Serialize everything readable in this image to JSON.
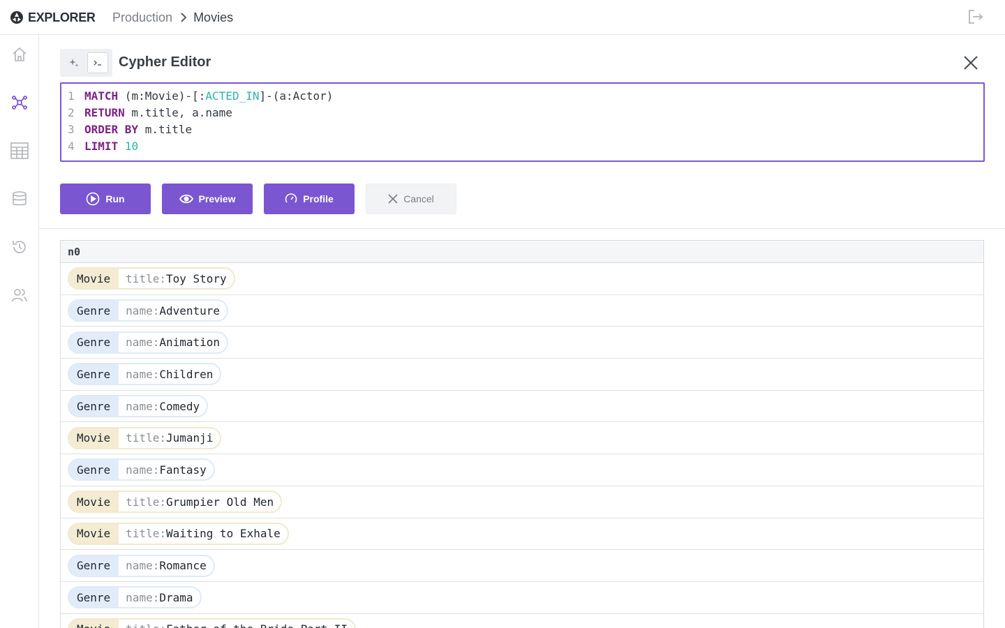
{
  "header": {
    "logo_text": "EXPLORER",
    "breadcrumb": {
      "parent": "Production",
      "current": "Movies"
    },
    "logout_icon": "logout-icon"
  },
  "sidebar": {
    "items": [
      {
        "name": "home",
        "icon": "home-icon",
        "active": false
      },
      {
        "name": "graph",
        "icon": "graph-icon",
        "active": true
      },
      {
        "name": "table",
        "icon": "table-icon",
        "active": false
      },
      {
        "name": "database",
        "icon": "database-icon",
        "active": false
      },
      {
        "name": "history",
        "icon": "history-icon",
        "active": false
      },
      {
        "name": "users",
        "icon": "users-icon",
        "active": false
      }
    ]
  },
  "editor": {
    "title": "Cypher Editor",
    "lines": [
      {
        "n": "1",
        "tokens": [
          {
            "t": "kw",
            "v": "MATCH"
          },
          {
            "t": "plain",
            "v": " (m:Movie)-[:"
          },
          {
            "t": "typ",
            "v": "ACTED_IN"
          },
          {
            "t": "plain",
            "v": "]-(a:Actor)"
          }
        ]
      },
      {
        "n": "2",
        "tokens": [
          {
            "t": "kw",
            "v": "RETURN"
          },
          {
            "t": "plain",
            "v": " m.title, a.name"
          }
        ]
      },
      {
        "n": "3",
        "tokens": [
          {
            "t": "kw",
            "v": "ORDER BY"
          },
          {
            "t": "plain",
            "v": " m.title"
          }
        ]
      },
      {
        "n": "4",
        "tokens": [
          {
            "t": "kw",
            "v": "LIMIT"
          },
          {
            "t": "plain",
            "v": " "
          },
          {
            "t": "num",
            "v": "10"
          }
        ]
      }
    ],
    "buttons": {
      "run": "Run",
      "preview": "Preview",
      "profile": "Profile",
      "cancel": "Cancel"
    }
  },
  "results": {
    "column": "n0",
    "rows": [
      {
        "label": "Movie",
        "key": "title:",
        "value": "Toy Story"
      },
      {
        "label": "Genre",
        "key": "name:",
        "value": "Adventure"
      },
      {
        "label": "Genre",
        "key": "name:",
        "value": "Animation"
      },
      {
        "label": "Genre",
        "key": "name:",
        "value": "Children"
      },
      {
        "label": "Genre",
        "key": "name:",
        "value": "Comedy"
      },
      {
        "label": "Movie",
        "key": "title:",
        "value": "Jumanji"
      },
      {
        "label": "Genre",
        "key": "name:",
        "value": "Fantasy"
      },
      {
        "label": "Movie",
        "key": "title:",
        "value": "Grumpier Old Men"
      },
      {
        "label": "Movie",
        "key": "title:",
        "value": "Waiting to Exhale"
      },
      {
        "label": "Genre",
        "key": "name:",
        "value": "Romance"
      },
      {
        "label": "Genre",
        "key": "name:",
        "value": "Drama"
      },
      {
        "label": "Movie",
        "key": "title:",
        "value": "Father of the Bride Part II"
      }
    ]
  },
  "colors": {
    "accent": "#7b56d1",
    "movie_chip": "#f3ebd2",
    "genre_chip": "#e2ecf9"
  }
}
